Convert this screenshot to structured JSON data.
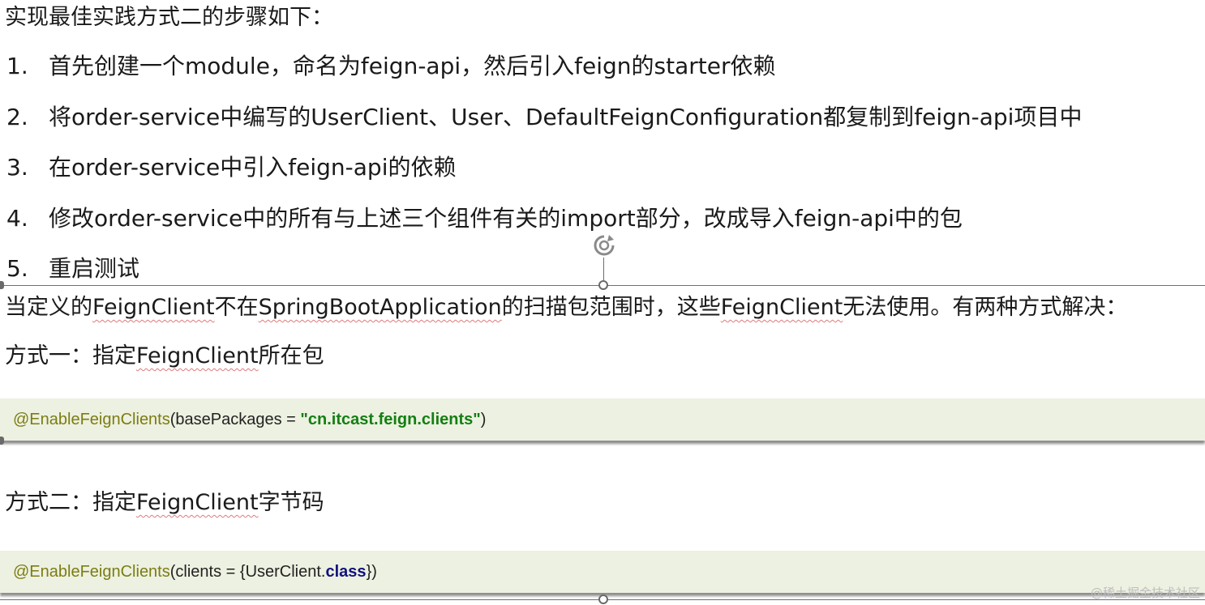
{
  "heading": "实现最佳实践方式二的步骤如下：",
  "steps": [
    {
      "num": "1.",
      "text": "首先创建一个module，命名为feign-api，然后引入feign的starter依赖"
    },
    {
      "num": "2.",
      "text": "将order-service中编写的UserClient、User、DefaultFeignConfiguration都复制到feign-api项目中"
    },
    {
      "num": "3.",
      "text": "在order-service中引入feign-api的依赖"
    },
    {
      "num": "4.",
      "text": "修改order-service中的所有与上述三个组件有关的import部分，改成导入feign-api中的包"
    },
    {
      "num": "5.",
      "text": "重启测试"
    }
  ],
  "para": {
    "p1": "当定义的",
    "p2": "FeignClient",
    "p3": "不在",
    "p4": "SpringBootApplication",
    "p5": "的扫描包范围时，这些",
    "p6": "FeignClient",
    "p7": "无法使用。有两种方式解决："
  },
  "way1": {
    "prefix": "方式一：指定",
    "term": "FeignClient",
    "suffix": "所在包"
  },
  "code1": {
    "annotation": "@EnableFeignClients",
    "open": "(basePackages = ",
    "string": "\"cn.itcast.feign.clients\"",
    "close": ")"
  },
  "way2": {
    "prefix": "方式二：指定",
    "term": "FeignClient",
    "suffix": "字节码"
  },
  "code2": {
    "annotation": "@EnableFeignClients",
    "open": "(clients = {UserClient.",
    "keyword": "class",
    "close": "})"
  },
  "watermark": "@稀土掘金技术社区",
  "colors": {
    "code_bg": "#edf1e1",
    "annotation": "#7c7c12",
    "string": "#137f13",
    "keyword": "#12127e",
    "spell_underline": "#e07a7a"
  }
}
